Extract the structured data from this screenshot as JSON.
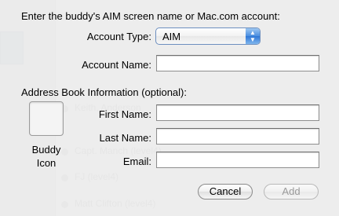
{
  "background_list": {
    "rows": [
      "Keith, Anderson",
      "Capt. Manch (level4)",
      "FJ (level4)",
      "Matt Clifton (level4)"
    ]
  },
  "dialog": {
    "prompt": "Enter the buddy's AIM screen name or Mac.com account:",
    "account_type_label": "Account Type:",
    "account_type_value": "AIM",
    "account_name_label": "Account Name:",
    "account_name_value": "",
    "address_book_heading": "Address Book Information (optional):",
    "buddy_icon_label_line1": "Buddy",
    "buddy_icon_label_line2": "Icon",
    "first_name_label": "First Name:",
    "first_name_value": "",
    "last_name_label": "Last Name:",
    "last_name_value": "",
    "email_label": "Email:",
    "email_value": "",
    "cancel_label": "Cancel",
    "add_label": "Add"
  }
}
